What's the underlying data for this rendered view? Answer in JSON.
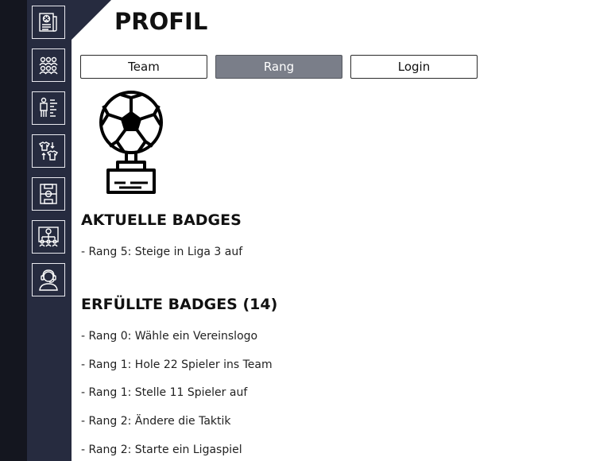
{
  "page": {
    "title": "PROFIL"
  },
  "sidebar": {
    "items": [
      {
        "icon": "news-icon"
      },
      {
        "icon": "team-lineup-icon"
      },
      {
        "icon": "player-stats-icon"
      },
      {
        "icon": "jersey-transfer-icon"
      },
      {
        "icon": "pitch-icon"
      },
      {
        "icon": "league-tree-icon"
      },
      {
        "icon": "manager-avatar-icon"
      }
    ]
  },
  "tabs": [
    {
      "label": "Team",
      "active": false
    },
    {
      "label": "Rang",
      "active": true
    },
    {
      "label": "Login",
      "active": false
    }
  ],
  "current_badges": {
    "title": "AKTUELLE BADGES",
    "items": [
      "- Rang 5: Steige in Liga 3 auf"
    ]
  },
  "completed_badges": {
    "title": "ERFÜLLTE BADGES (14)",
    "items": [
      "- Rang 0: Wähle ein Vereinslogo",
      "- Rang 1: Hole 22 Spieler ins Team",
      "- Rang 1: Stelle 11 Spieler auf",
      "- Rang 2: Ändere die Taktik",
      "- Rang 2: Starte ein Ligaspiel"
    ]
  },
  "colors": {
    "sidebar": "#262b3f",
    "left_edge": "#14161f",
    "active_tab": "#7a7e89",
    "text": "#111111"
  }
}
